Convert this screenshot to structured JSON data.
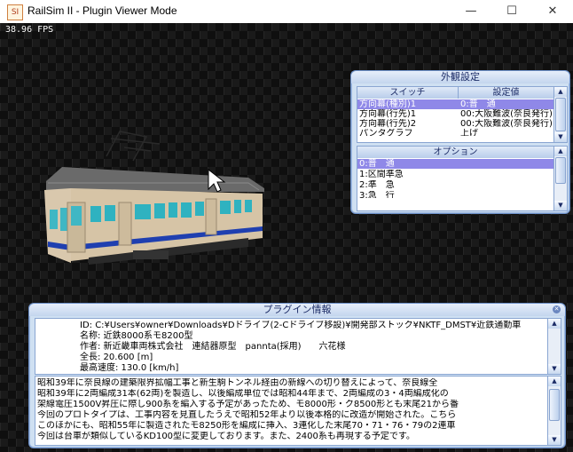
{
  "window": {
    "title": "RailSim II - Plugin Viewer Mode",
    "minimize": "—",
    "maximize": "☐",
    "close": "✕",
    "icon_text": "SI"
  },
  "viewport": {
    "fps": "38.96 FPS"
  },
  "appearance_panel": {
    "title": "外観設定",
    "col_switch": "スイッチ",
    "col_value": "設定値",
    "rows": [
      {
        "switch": "方向幕(種別)1",
        "value": "0:普　通",
        "selected": true
      },
      {
        "switch": "方向幕(行先)1",
        "value": "00:大阪難波(奈良発行)"
      },
      {
        "switch": "方向幕(行先)2",
        "value": "00:大阪難波(奈良発行)"
      },
      {
        "switch": "パンタグラフ",
        "value": "上げ"
      }
    ],
    "options_header": "オプション",
    "options": [
      "0:普　通",
      "1:区間準急",
      "2:準　急",
      "3:急　行"
    ]
  },
  "plugin_info": {
    "title": "プラグイン情報",
    "id_line": "ID: C:¥Users¥owner¥Downloads¥Dドライブ(2-Cドライブ移設)¥開発部ストック¥NKTF_DMST¥近鉄通勤車",
    "name_line": "名称: 近鉄8000系モ8200型",
    "author_line": "作者: 新近畿車両株式会社　連結器原型　pannta(採用)　　六花様",
    "length_line": "全長: 20.600 [m]",
    "speed_line": "最高速度: 130.0 [km/h]",
    "description": [
      "昭和39年に奈良線の建築限界拡幅工事と新生駒トンネル経由の新線への切り替えによって、奈良線全",
      "昭和39年に2両編成31本(62両)を製造し、以後編成単位では昭和44年まで、2両編成の3・4両編成化の",
      "架線電圧1500V昇圧に際し900系を編入する予定があったため、モ8000形・ク8500形とも末尾21から番",
      "今回のプロトタイプは、工事内容を見直したうえで昭和52年より以後本格的に改造が開始された。こちら",
      "このほかにも、昭和55年に製造されたモ8250形を編成に挿入、3連化した末尾70・71・76・79の2連車",
      "今回は台車が類似しているKD100型に変更しております。また、2400系も再現する予定です。"
    ]
  }
}
